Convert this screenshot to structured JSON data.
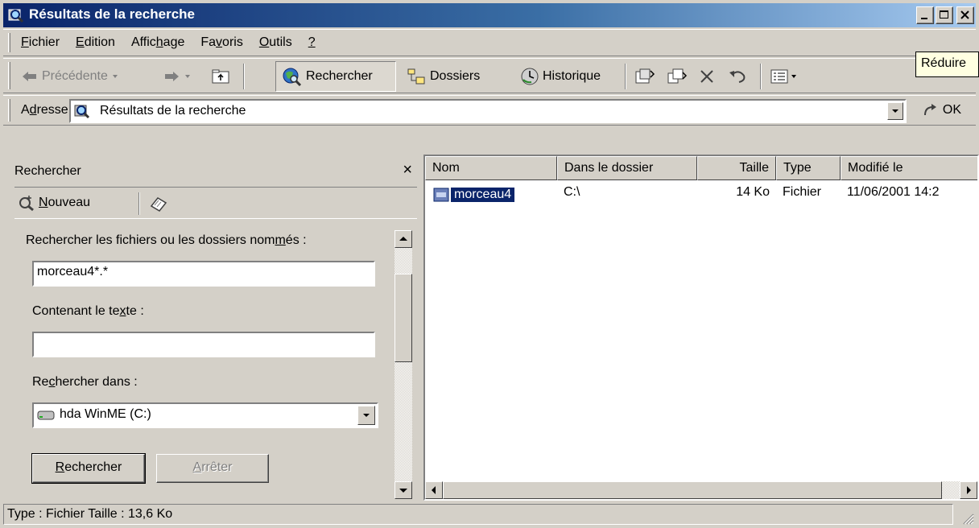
{
  "window": {
    "title": "Résultats de la recherche",
    "title_icon": "search-results-icon",
    "controls": [
      "minimize",
      "maximize",
      "close"
    ]
  },
  "menu": {
    "items": [
      {
        "pre": "",
        "key": "F",
        "post": "ichier"
      },
      {
        "pre": "",
        "key": "E",
        "post": "dition"
      },
      {
        "pre": "Affic",
        "key": "h",
        "post": "age"
      },
      {
        "pre": "Fa",
        "key": "v",
        "post": "oris"
      },
      {
        "pre": "",
        "key": "O",
        "post": "utils"
      },
      {
        "pre": "",
        "key": "?",
        "post": ""
      }
    ]
  },
  "tooltip": "Réduire",
  "toolbar": {
    "back": "Précédente",
    "search": "Rechercher",
    "folders": "Dossiers",
    "history": "Historique"
  },
  "address": {
    "label_pre": "A",
    "label_key": "d",
    "label_post": "resse",
    "value": "Résultats de la recherche",
    "go": "OK"
  },
  "search_pane": {
    "title": "Rechercher",
    "close": "×",
    "new_key": "N",
    "new_post": "ouveau",
    "names_label_pre": "Rechercher les fichiers ou les dossiers nom",
    "names_label_key": "m",
    "names_label_post": "és :",
    "names_value": "morceau4*.*",
    "text_label_pre": "Contenant le te",
    "text_label_key": "x",
    "text_label_post": "te :",
    "text_value": "",
    "lookin_label_pre": "Re",
    "lookin_label_key": "c",
    "lookin_label_post": "hercher dans :",
    "lookin_value": "hda WinME (C:)",
    "search_btn_key": "R",
    "search_btn_post": "echercher",
    "stop_btn_key": "A",
    "stop_btn_post": "rrêter"
  },
  "results": {
    "columns": [
      "Nom",
      "Dans le dossier",
      "Taille",
      "Type",
      "Modifié le"
    ],
    "rows": [
      {
        "name": "morceau4",
        "folder": "C:\\",
        "size": "14 Ko",
        "type": "Fichier",
        "modified": "11/06/2001 14:2"
      }
    ]
  },
  "status": "Type : Fichier Taille  : 13,6 Ko",
  "colors": {
    "title_start": "#0a246a",
    "title_end": "#a6caf0",
    "selection": "#0a246a",
    "face": "#d4d0c8"
  }
}
